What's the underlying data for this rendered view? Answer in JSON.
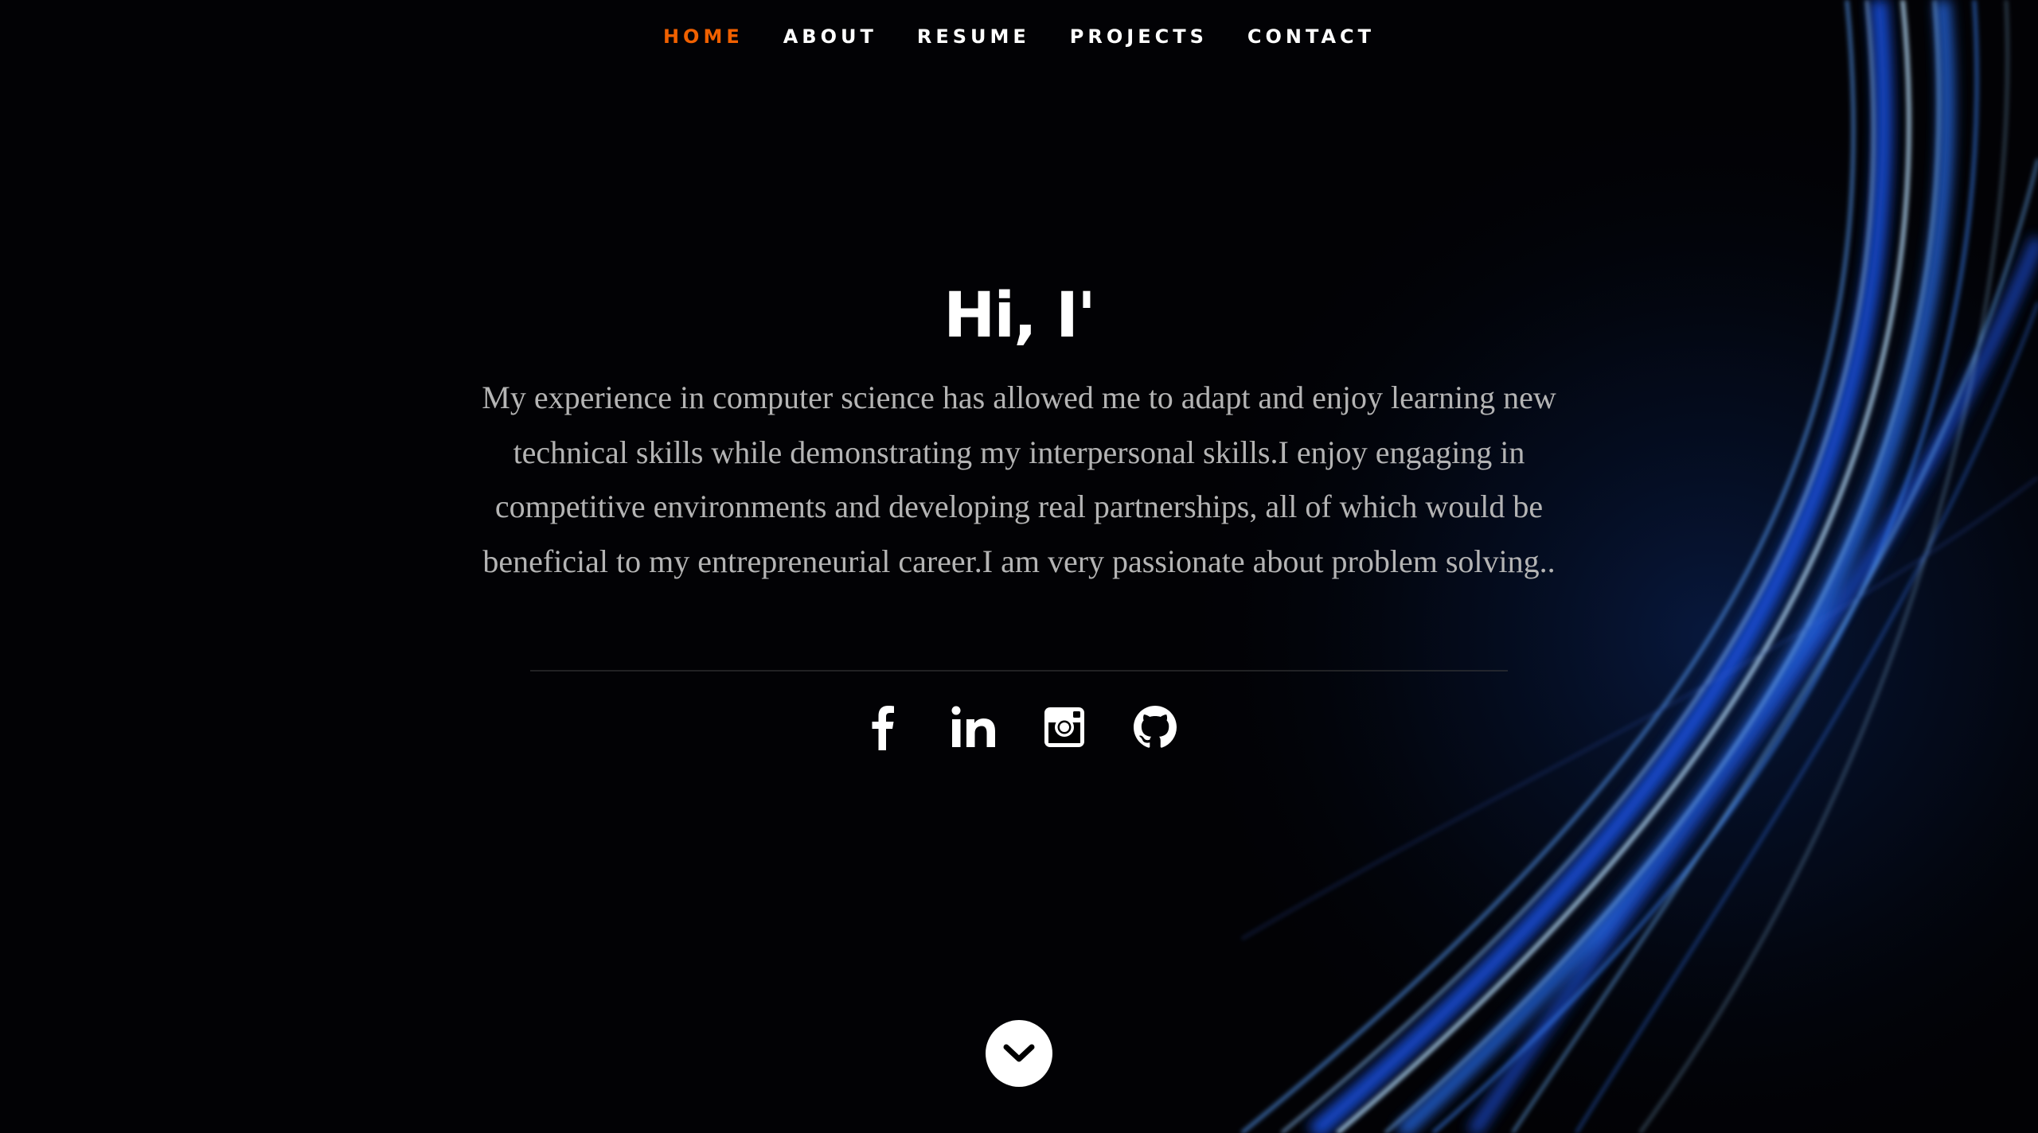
{
  "nav": {
    "items": [
      {
        "label": "HOME",
        "active": true
      },
      {
        "label": "ABOUT",
        "active": false
      },
      {
        "label": "RESUME",
        "active": false
      },
      {
        "label": "PROJECTS",
        "active": false
      },
      {
        "label": "CONTACT",
        "active": false
      }
    ],
    "active_color": "#f06000",
    "text_color": "#ffffff"
  },
  "hero": {
    "title": "Hi, I'",
    "description": "My experience in computer science has allowed me to adapt and enjoy learning new technical skills while demonstrating my interpersonal skills.I enjoy engaging in competitive environments and developing real partnerships, all of which would be beneficial to my entrepreneurial career.I am very passionate about problem solving.."
  },
  "socials": [
    {
      "icon": "facebook-icon"
    },
    {
      "icon": "linkedin-icon"
    },
    {
      "icon": "instagram-icon"
    },
    {
      "icon": "github-icon"
    }
  ],
  "scroll_button": {
    "icon": "chevron-down-icon"
  },
  "colors": {
    "background": "#020205",
    "accent_light": "#4aa8ff",
    "description_text": "#b4b4b4"
  }
}
